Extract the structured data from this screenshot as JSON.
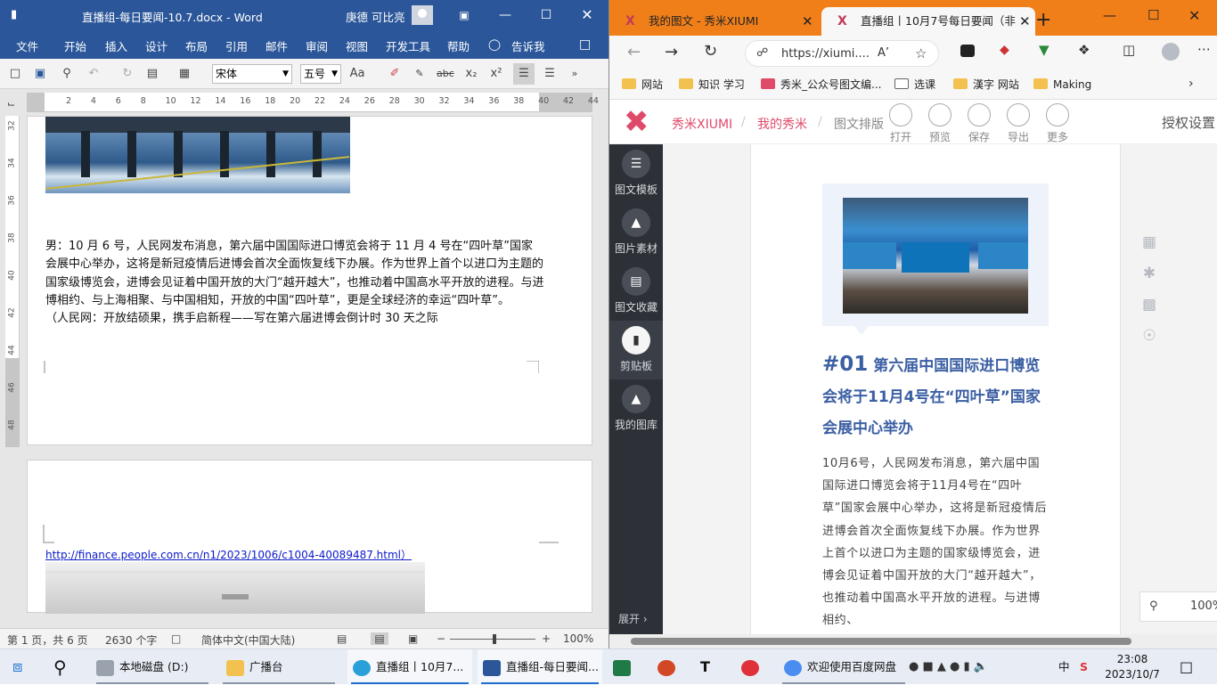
{
  "word": {
    "title": "直播组-每日要闻-10.7.docx  -  Word",
    "user": "庚德 可比亮",
    "menu": [
      "文件",
      "开始",
      "插入",
      "设计",
      "布局",
      "引用",
      "邮件",
      "审阅",
      "视图",
      "开发工具",
      "帮助",
      "告诉我"
    ],
    "font_name": "宋体",
    "font_size": "五号",
    "ruler_h": [
      "2",
      "4",
      "6",
      "8",
      "10",
      "12",
      "14",
      "16",
      "18",
      "20",
      "22",
      "24",
      "26",
      "28",
      "30",
      "32",
      "34",
      "36",
      "38",
      "40",
      "42",
      "44"
    ],
    "ruler_v": [
      "32",
      "34",
      "36",
      "38",
      "40",
      "42",
      "44",
      "46",
      "48"
    ],
    "paragraphs": [
      "男：10 月 6 号，人民网发布消息，第六届中国国际进口博览会将于 11 月 4 号在“四叶草”国家会展中心举办，这将是新冠疫情后进博会首次全面恢复线下办展。作为世界上首个以进口为主题的国家级博览会，进博会见证着中国开放的大门“越开越大”，也推动着中国高水平开放的进程。与进博相约、与上海相聚、与中国相知，开放的中国“四叶草”，更是全球经济的幸运“四叶草”。",
      "（人民网：开放结硕果，携手启新程——写在第六届进博会倒计时 30 天之际"
    ],
    "link": "http://finance.people.com.cn/n1/2023/1006/c1004-40089487.html）",
    "status": {
      "page": "第 1 页，共 6 页",
      "words": "2630 个字",
      "lang": "简体中文(中国大陆)",
      "zoom": "100%"
    }
  },
  "browser": {
    "tabs": [
      "我的图文 - 秀米XIUMI",
      "直播组丨10月7号每日要闻（非"
    ],
    "url": "https://xiumi....",
    "bookmarks": [
      "网站",
      "知识 学习",
      "秀米_公众号图文编...",
      "选课",
      "漢字 网站",
      "Making"
    ],
    "xiumi": {
      "crumbs": [
        "秀米XIUMI",
        "我的秀米",
        "图文排版"
      ],
      "tools": [
        "打开",
        "预览",
        "保存",
        "导出",
        "更多"
      ],
      "auth": "授权设置",
      "side": [
        "图文模板",
        "图片素材",
        "图文收藏",
        "剪贴板",
        "我的图库"
      ],
      "expand": "展开",
      "article_no": "#01",
      "article_title": "第六届中国国际进口博览会将于11月4号在“四叶草”国家会展中心举办",
      "article_body": "10月6号，人民网发布消息，第六届中国国际进口博览会将于11月4号在“四叶草”国家会展中心举办，这将是新冠疫情后进博会首次全面恢复线下办展。作为世界上首个以进口为主题的国家级博览会，进博会见证着中国开放的大门“越开越大”，也推动着中国高水平开放的进程。与进博相约、",
      "zoom": "100%"
    }
  },
  "taskbar": {
    "items": [
      "本地磁盘 (D:)",
      "广播台",
      "直播组丨10月7...",
      "直播组-每日要闻...",
      "欢迎使用百度网盘"
    ],
    "ime": "中",
    "time": "23:08",
    "date": "2023/10/7"
  }
}
